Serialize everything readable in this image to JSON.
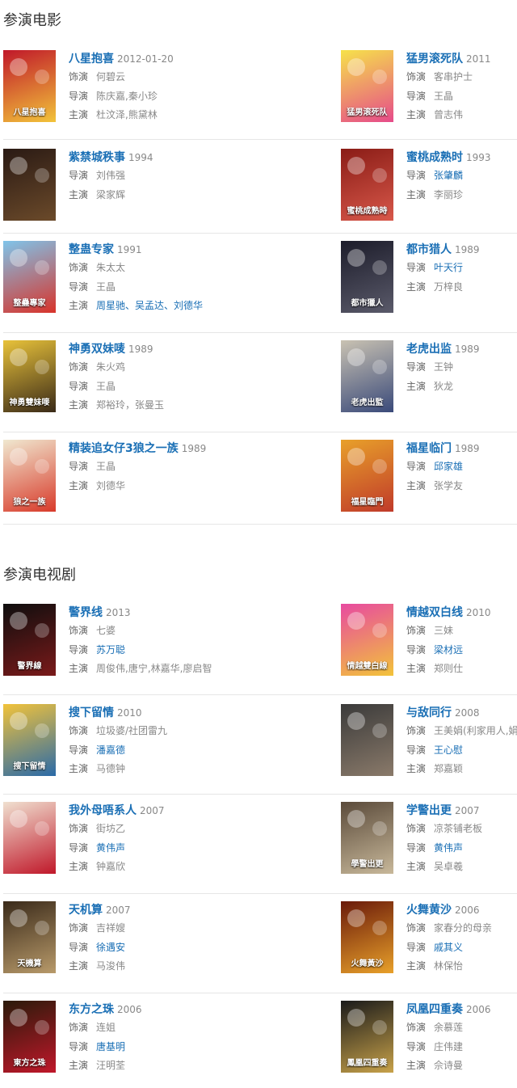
{
  "sections": [
    {
      "title": "参演电影",
      "rows": [
        [
          {
            "title": "八星抱喜",
            "year": "2012-01-20",
            "colors": [
              "#c0182a",
              "#f2c33a"
            ],
            "poster_text": "八星抱喜",
            "meta": [
              {
                "k": "饰演",
                "v": "何碧云"
              },
              {
                "k": "导演",
                "v": "陈庆嘉,秦小珍"
              },
              {
                "k": "主演",
                "v": "杜汶泽,熊黛林"
              }
            ]
          },
          {
            "title": "猛男滚死队",
            "year": "2011",
            "colors": [
              "#f6e24a",
              "#e64b8a"
            ],
            "poster_text": "猛男滚死队",
            "meta": [
              {
                "k": "饰演",
                "v": "客串护士"
              },
              {
                "k": "导演",
                "v": "王晶"
              },
              {
                "k": "主演",
                "v": "曾志伟"
              }
            ]
          }
        ],
        [
          {
            "title": "紫禁城秩事",
            "year": "1994",
            "colors": [
              "#2a1a14",
              "#6b4a2a"
            ],
            "poster_text": "",
            "meta": [
              {
                "k": "导演",
                "v": "刘伟强"
              },
              {
                "k": "主演",
                "v": "梁家辉"
              }
            ]
          },
          {
            "title": "蜜桃成熟时",
            "year": "1993",
            "colors": [
              "#8a1c16",
              "#d8584a"
            ],
            "poster_text": "蜜桃成熟時",
            "meta": [
              {
                "k": "导演",
                "v": "张肇麟",
                "link": true
              },
              {
                "k": "主演",
                "v": "李丽珍"
              }
            ]
          }
        ],
        [
          {
            "title": "整蛊专家",
            "year": "1991",
            "colors": [
              "#7fc4ea",
              "#d8332a"
            ],
            "poster_text": "整蠱專家",
            "meta": [
              {
                "k": "饰演",
                "v": "朱太太"
              },
              {
                "k": "导演",
                "v": "王晶"
              },
              {
                "k": "主演",
                "v": "周星驰、吴孟达、刘德华",
                "link": true
              }
            ]
          },
          {
            "title": "都市猎人",
            "year": "1989",
            "colors": [
              "#1c1c2a",
              "#5a5a6a"
            ],
            "poster_text": "都市獵人",
            "meta": [
              {
                "k": "导演",
                "v": "叶天行",
                "link": true
              },
              {
                "k": "主演",
                "v": "万梓良"
              }
            ]
          }
        ],
        [
          {
            "title": "神勇双妹唛",
            "year": "1989",
            "colors": [
              "#e8c23a",
              "#3a2a18"
            ],
            "poster_text": "神勇雙妹嘜",
            "meta": [
              {
                "k": "饰演",
                "v": "朱火鸡"
              },
              {
                "k": "导演",
                "v": "王晶"
              },
              {
                "k": "主演",
                "v": "郑裕玲，张曼玉"
              }
            ]
          },
          {
            "title": "老虎出监",
            "year": "1989",
            "colors": [
              "#c9c2b2",
              "#3a4a7a"
            ],
            "poster_text": "老虎出監",
            "meta": [
              {
                "k": "导演",
                "v": "王钟"
              },
              {
                "k": "主演",
                "v": "狄龙"
              }
            ]
          }
        ],
        [
          {
            "title": "精装追女仔3狼之一族",
            "year": "1989",
            "colors": [
              "#f0e8d0",
              "#d83a2a"
            ],
            "poster_text": "狼之一族",
            "meta": [
              {
                "k": "导演",
                "v": "王晶"
              },
              {
                "k": "主演",
                "v": "刘德华"
              }
            ]
          },
          {
            "title": "福星临门",
            "year": "1989",
            "colors": [
              "#e8a02a",
              "#c03a2a"
            ],
            "poster_text": "福星臨門",
            "meta": [
              {
                "k": "导演",
                "v": "邱家雄",
                "link": true
              },
              {
                "k": "主演",
                "v": "张学友"
              }
            ]
          }
        ]
      ]
    },
    {
      "title": "参演电视剧",
      "rows": [
        [
          {
            "title": "警界线",
            "year": "2013",
            "colors": [
              "#0e0e0e",
              "#7a1a1a"
            ],
            "poster_text": "警界線",
            "meta": [
              {
                "k": "饰演",
                "v": "七婆"
              },
              {
                "k": "导演",
                "v": "苏万聪",
                "link": true
              },
              {
                "k": "主演",
                "v": "周俊伟,唐宁,林嘉华,廖启智"
              }
            ]
          },
          {
            "title": "情越双白线",
            "year": "2010",
            "colors": [
              "#e84aa0",
              "#f2c33a"
            ],
            "poster_text": "情越雙白線",
            "meta": [
              {
                "k": "饰演",
                "v": "三妹"
              },
              {
                "k": "导演",
                "v": "梁材远",
                "link": true
              },
              {
                "k": "主演",
                "v": "郑则仕"
              }
            ]
          }
        ],
        [
          {
            "title": "搜下留情",
            "year": "2010",
            "colors": [
              "#f2c33a",
              "#2a6aa8"
            ],
            "poster_text": "搜下留情",
            "meta": [
              {
                "k": "饰演",
                "v": "垃圾婆/社团雷九"
              },
              {
                "k": "导演",
                "v": "潘嘉德",
                "link": true
              },
              {
                "k": "主演",
                "v": "马德钟"
              }
            ]
          },
          {
            "title": "与敌同行",
            "year": "2008",
            "colors": [
              "#3a3a3a",
              "#8a7a6a"
            ],
            "poster_text": "",
            "meta": [
              {
                "k": "饰演",
                "v": "王美娟(利家用人,娟姐)"
              },
              {
                "k": "导演",
                "v": "王心慰",
                "link": true
              },
              {
                "k": "主演",
                "v": "郑嘉颖"
              }
            ]
          }
        ],
        [
          {
            "title": "我外母唔系人",
            "year": "2007",
            "colors": [
              "#f0e0d0",
              "#c0182a"
            ],
            "poster_text": "",
            "meta": [
              {
                "k": "饰演",
                "v": "街坊乙"
              },
              {
                "k": "导演",
                "v": "黄伟声",
                "link": true
              },
              {
                "k": "主演",
                "v": "钟嘉欣"
              }
            ]
          },
          {
            "title": "学警出更",
            "year": "2007",
            "colors": [
              "#5a4a3a",
              "#c8b89a"
            ],
            "poster_text": "學警出更",
            "meta": [
              {
                "k": "饰演",
                "v": "凉茶铺老板"
              },
              {
                "k": "导演",
                "v": "黄伟声",
                "link": true
              },
              {
                "k": "主演",
                "v": "吴卓羲"
              }
            ]
          }
        ],
        [
          {
            "title": "天机算",
            "year": "2007",
            "colors": [
              "#3a2a1a",
              "#b89a6a"
            ],
            "poster_text": "天機算",
            "meta": [
              {
                "k": "饰演",
                "v": "吉祥嫂"
              },
              {
                "k": "导演",
                "v": "徐遇安",
                "link": true
              },
              {
                "k": "主演",
                "v": "马浚伟"
              }
            ]
          },
          {
            "title": "火舞黄沙",
            "year": "2006",
            "colors": [
              "#6a1a0a",
              "#e8a02a"
            ],
            "poster_text": "火舞黃沙",
            "meta": [
              {
                "k": "饰演",
                "v": "家春分的母亲"
              },
              {
                "k": "导演",
                "v": "戚其义",
                "link": true
              },
              {
                "k": "主演",
                "v": "林保怡"
              }
            ]
          }
        ],
        [
          {
            "title": "东方之珠",
            "year": "2006",
            "colors": [
              "#2a1a0a",
              "#c0182a"
            ],
            "poster_text": "東方之珠",
            "meta": [
              {
                "k": "饰演",
                "v": "连姐"
              },
              {
                "k": "导演",
                "v": "唐基明",
                "link": true
              },
              {
                "k": "主演",
                "v": "汪明荃"
              }
            ]
          },
          {
            "title": "凤凰四重奏",
            "year": "2006",
            "colors": [
              "#1a1a1a",
              "#c8a24a"
            ],
            "poster_text": "鳳凰四重奏",
            "meta": [
              {
                "k": "饰演",
                "v": "余慕莲"
              },
              {
                "k": "导演",
                "v": "庄伟建"
              },
              {
                "k": "主演",
                "v": "佘诗曼"
              }
            ]
          }
        ]
      ]
    }
  ]
}
